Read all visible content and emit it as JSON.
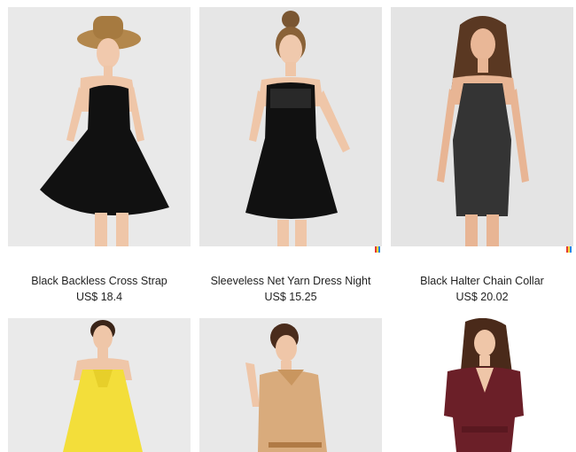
{
  "products": [
    {
      "title": "Black Backless Cross Strap",
      "price": "US$ 18.4",
      "image": "dress-photo",
      "dress_color": "#111111"
    },
    {
      "title": "Sleeveless Net Yarn Dress Night",
      "price": "US$ 15.25",
      "image": "dress-photo",
      "dress_color": "#111111"
    },
    {
      "title": "Black Halter Chain Collar",
      "price": "US$ 20.02",
      "image": "dress-photo",
      "dress_color": "#2a2a2a"
    },
    {
      "title": "",
      "price": "",
      "image": "dress-photo",
      "dress_color": "#f3de3a"
    },
    {
      "title": "",
      "price": "",
      "image": "dress-photo",
      "dress_color": "#d9ab7c"
    },
    {
      "title": "",
      "price": "",
      "image": "dress-photo",
      "dress_color": "#6b1f28"
    }
  ],
  "colors": {
    "background": "#ffffff",
    "photo_bg": "#e6e6e6",
    "text": "#222222"
  }
}
